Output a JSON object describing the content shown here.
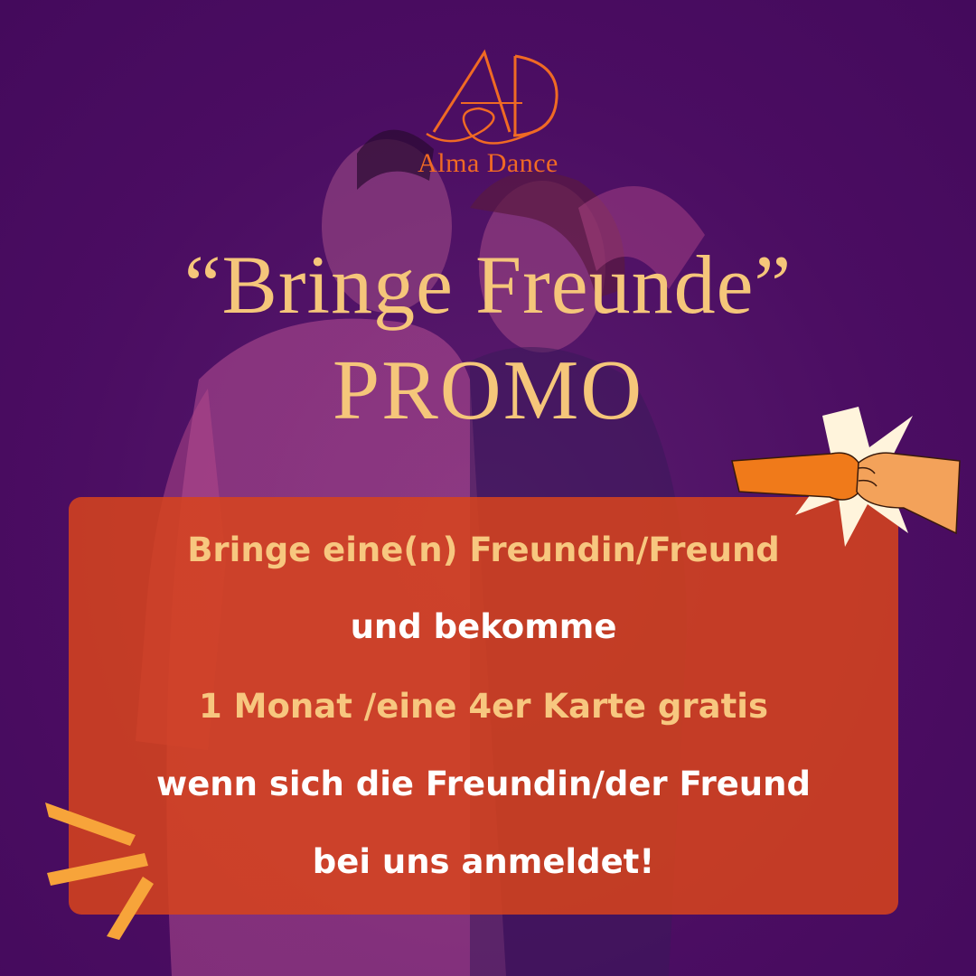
{
  "brand": {
    "name": "Alma Dance",
    "color": "#f06a24"
  },
  "headline": {
    "line1": "“Bringe Freunde”",
    "line2": "PROMO",
    "color": "#f5c67a"
  },
  "offer": {
    "line1": "Bringe eine(n) Freundin/Freund",
    "line2": "und bekomme",
    "line3": "1 Monat /eine 4er Karte gratis",
    "line4": "wenn sich die Freundin/der Freund",
    "line5": "bei uns anmeldet!",
    "box_color": "#d7441c"
  },
  "colors": {
    "background": "#4b0d62",
    "accent_orange": "#f07a1a",
    "star": "#fff4dc"
  },
  "icons": [
    "alma-dance-logo",
    "fist-bump-icon",
    "starburst-icon",
    "burst-lines-icon"
  ]
}
